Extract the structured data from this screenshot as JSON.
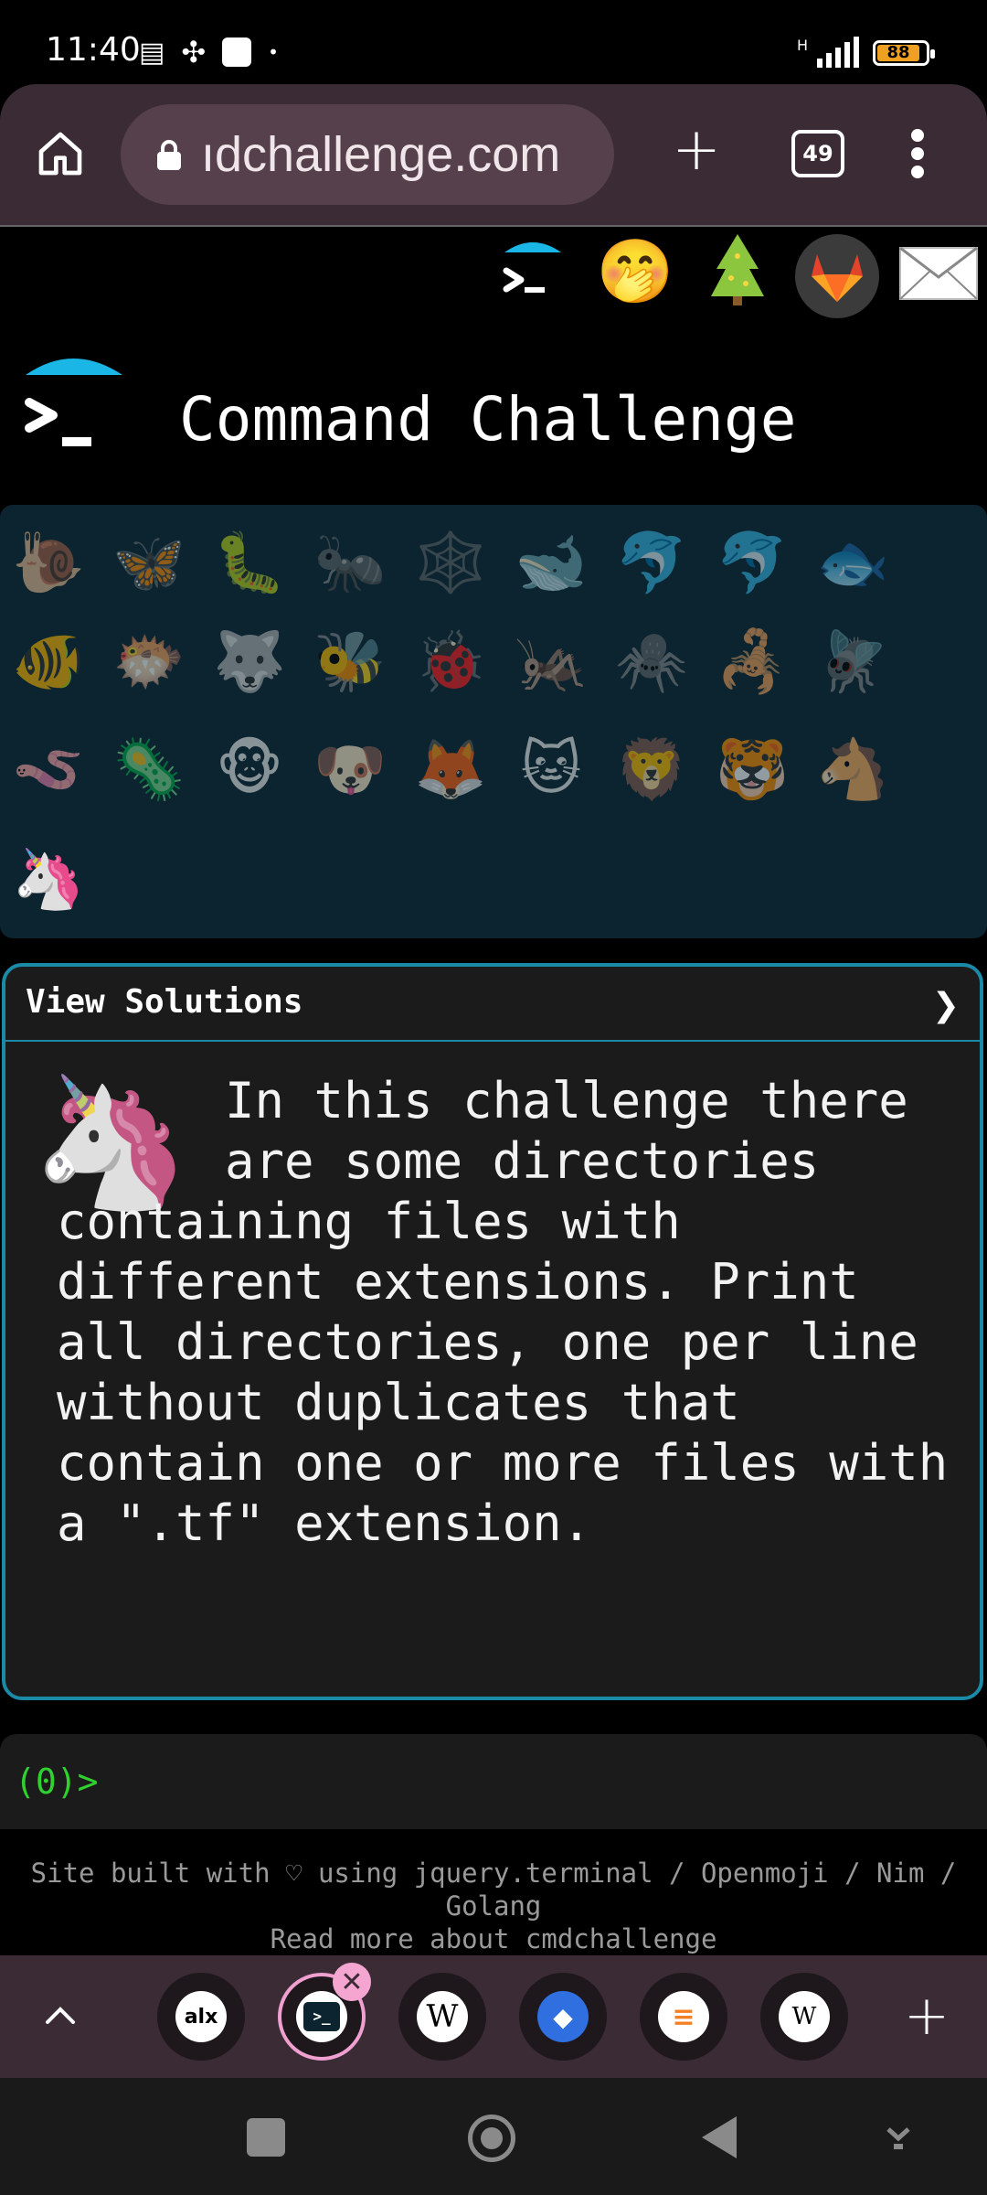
{
  "status_bar": {
    "time": "11:40",
    "battery": "88",
    "network": "H"
  },
  "browser": {
    "url": "ıdchallenge.com",
    "tab_count": "49"
  },
  "site": {
    "title": "Command Challenge",
    "top_icons": [
      "terminal-icon",
      "shushing-face-icon",
      "tree-icon",
      "gitlab-icon",
      "envelope-icon"
    ],
    "animals_row1": [
      "🐌",
      "🦋",
      "🐛",
      "🐜",
      "🕸️",
      "🐋",
      "🐬",
      "🐬",
      "🐟"
    ],
    "animals_row2": [
      "🐠",
      "🐡",
      "🐺",
      "🐝",
      "🐞",
      "🦗",
      "🕷️",
      "🦂",
      "🪰"
    ],
    "animals_row3": [
      "🪱",
      "🦠",
      "🐵",
      "🐶",
      "🦊",
      "🐱",
      "🦁",
      "🐯",
      "🐴"
    ],
    "animals_row4": [
      "🦄"
    ]
  },
  "solutions": {
    "header": "View Solutions",
    "chevron": "❯",
    "description_line1": "In this challenge there",
    "description_line2": "are some directories",
    "description_rest": "containing files with different extensions. Print all directories, one per line without duplicates that contain one or more files with a \".tf\" extension."
  },
  "terminal": {
    "prompt": "(0)>"
  },
  "footer": {
    "built_with": "Site built with ♡ using jquery.terminal / Openmoji / Nim / Golang",
    "read_more": "Read more about cmdchallenge"
  },
  "tabs": {
    "items": [
      {
        "name": "alx-tab",
        "label": "alx",
        "bg": "#ffffff",
        "fg": "#000000"
      },
      {
        "name": "cmdchallenge-tab",
        "label": ">_",
        "bg": "#ffffff",
        "fg": "#000000"
      },
      {
        "name": "wikipedia-tab",
        "label": "W",
        "bg": "#ffffff",
        "fg": "#000000"
      },
      {
        "name": "jira-tab",
        "label": "◆",
        "bg": "#2f6fe0",
        "fg": "#ffffff"
      },
      {
        "name": "stackoverflow-tab",
        "label": "≡",
        "bg": "#ffffff",
        "fg": "#f48024"
      },
      {
        "name": "wikipedia-tab-2",
        "label": "W",
        "bg": "#ffffff",
        "fg": "#000000"
      }
    ]
  },
  "colors": {
    "accent": "#1a8aa7",
    "prompt": "#2fd12f",
    "toolbar": "#3a2b34"
  }
}
